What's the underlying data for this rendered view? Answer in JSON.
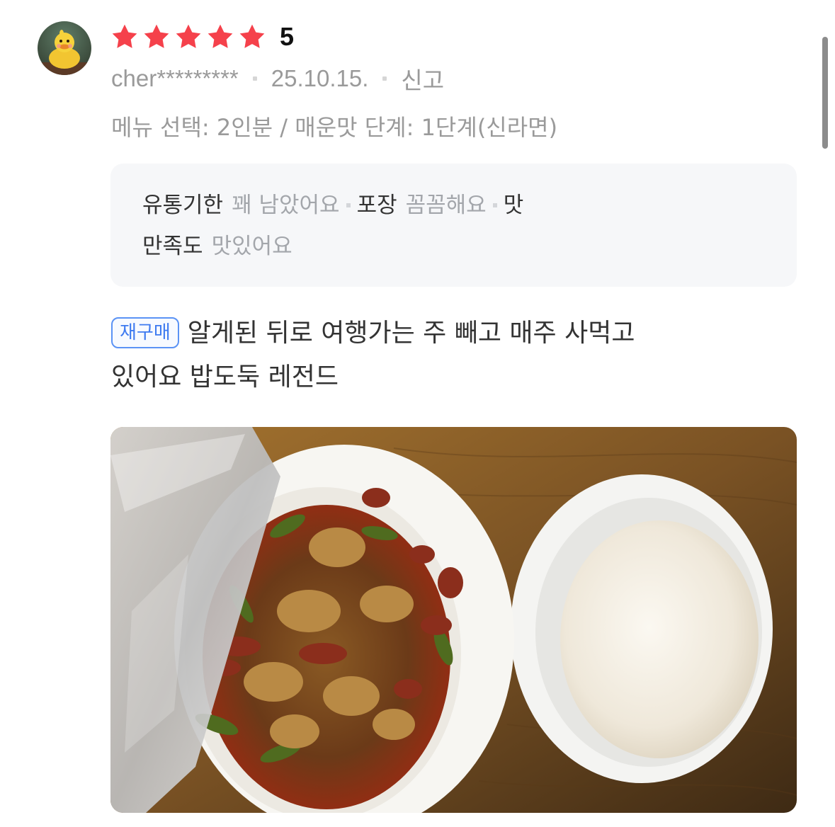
{
  "review": {
    "rating": 5,
    "rating_label": "5",
    "stars_total": 5,
    "username": "cher*********",
    "date": "25.10.15.",
    "report_label": "신고",
    "options": "메뉴 선택: 2인분 / 매운맛 단계: 1단계(신라면)",
    "summary": [
      {
        "key": "유통기한",
        "value": "꽤 남았어요"
      },
      {
        "key": "포장",
        "value": "꼼꼼해요"
      },
      {
        "key": "맛",
        "value": ""
      },
      {
        "key": "만족도",
        "value": "맛있어요"
      }
    ],
    "badge": "재구매",
    "text_line1": "알게된 뒤로 여행가는 주 빼고 매주 사먹고",
    "text_line2": "있어요 밥도둑 레전드"
  },
  "colors": {
    "star": "#f5414b",
    "badge": "#3d7af0",
    "muted_text": "#9a9a9a",
    "summary_bg": "#f6f7f9"
  },
  "icons": {
    "star": "star-icon",
    "avatar": "duck-avatar"
  }
}
